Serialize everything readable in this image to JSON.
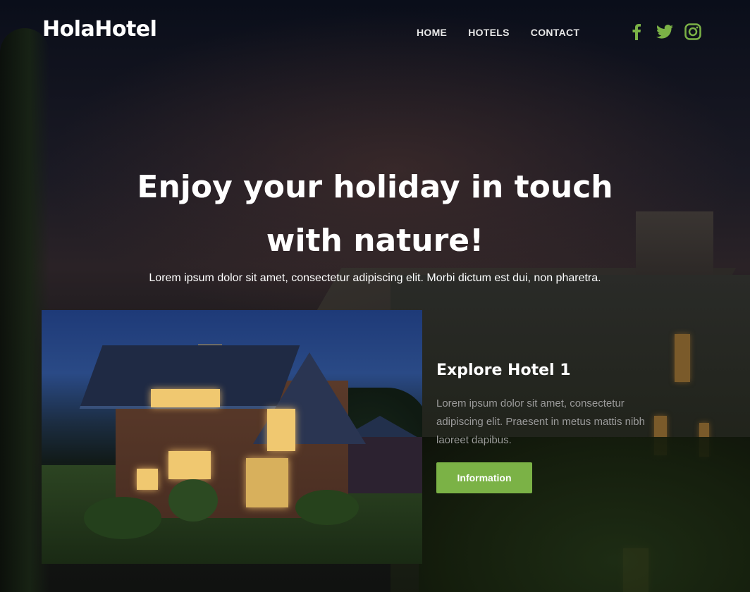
{
  "header": {
    "logo": "HolaHotel",
    "nav": [
      {
        "label": "HOME"
      },
      {
        "label": "HOTELS"
      },
      {
        "label": "CONTACT"
      }
    ],
    "social": [
      {
        "icon": "facebook-icon"
      },
      {
        "icon": "twitter-icon"
      },
      {
        "icon": "instagram-icon"
      }
    ],
    "social_color": "#7bb246"
  },
  "hero": {
    "title": "Enjoy your holiday in touch with nature!",
    "subtitle": "Lorem ipsum dolor sit amet, consectetur adipiscing elit. Morbi dictum est dui, non pharetra."
  },
  "hotel_card": {
    "title": "Explore Hotel 1",
    "description": "Lorem ipsum dolor sit amet, consectetur adipiscing elit. Praesent in metus mattis nibh laoreet dapibus.",
    "button_label": "Information",
    "accent": "#7bb246"
  }
}
